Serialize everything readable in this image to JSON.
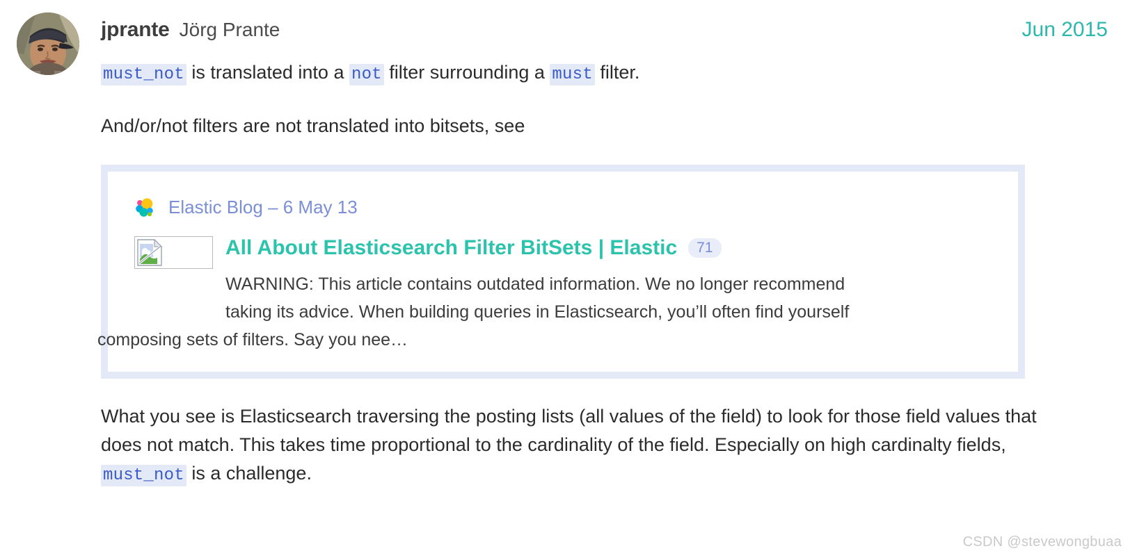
{
  "post": {
    "author": {
      "username": "jprante",
      "fullname": "Jörg Prante",
      "avatar_alt": "jprante-avatar"
    },
    "date": "Jun 2015",
    "paragraph_1": {
      "code_1": "must_not",
      "text_1": " is translated into a ",
      "code_2": "not",
      "text_2": " filter surrounding a ",
      "code_3": "must",
      "text_3": " filter."
    },
    "paragraph_2": "And/or/not filters are not translated into bitsets, see",
    "paragraph_3": {
      "text_1": "What you see is Elasticsearch traversing the posting lists (all values of the field) to look for those field values that does not match. This takes time proportional to the cardinality of the field. Especially on high cardinalty fields, ",
      "code_1": "must_not",
      "text_2": " is a challenge."
    }
  },
  "onebox": {
    "source_label": "Elastic Blog – 6 May 13",
    "source_icon": "elastic-logo-icon",
    "thumbnail_icon": "broken-image-icon",
    "title": "All About Elasticsearch Filter BitSets | Elastic",
    "badge": "71",
    "description_lines": [
      "WARNING: This article contains outdated information. We no longer recommend",
      "taking its advice. When building queries in Elasticsearch, you’ll often find yourself",
      "composing sets of filters. Say you nee…"
    ]
  },
  "watermark": "CSDN @stevewongbuaa",
  "colors": {
    "date_teal": "#2cb8ac",
    "title_teal": "#2cc3ad",
    "code_blue": "#3a5bc7",
    "code_bg": "#e4e9f7",
    "source_blue": "#7b8fd6",
    "badge_bg": "#e9edf9",
    "card_border": "#e4e9f7"
  }
}
